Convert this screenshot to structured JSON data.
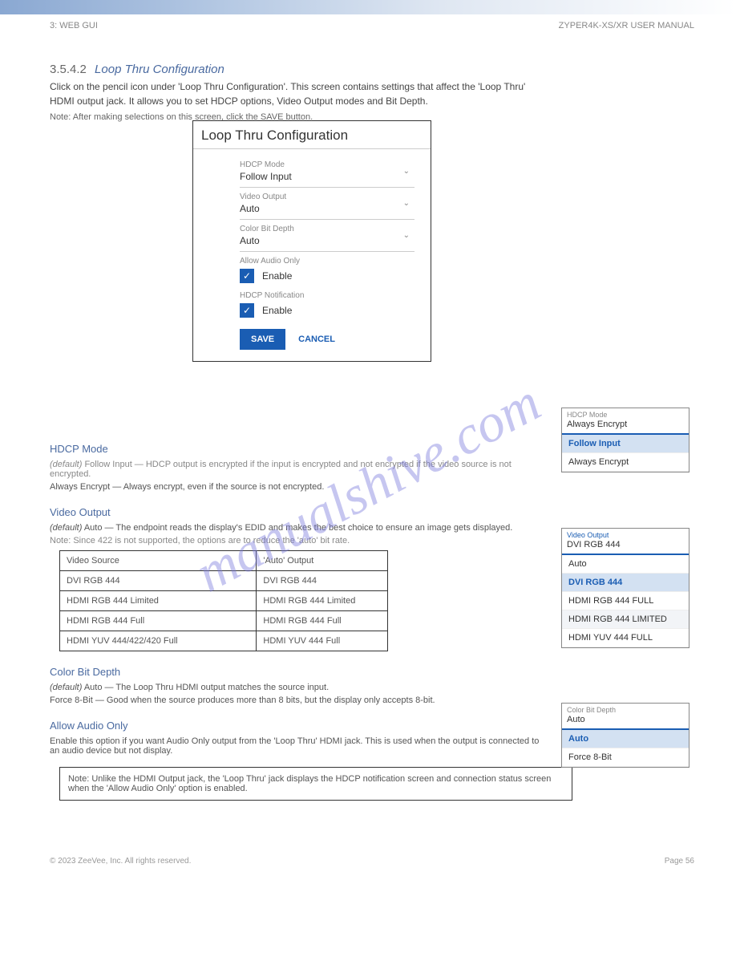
{
  "header": {
    "page_ref": "3: WEB GUI",
    "doc_title": "ZYPER4K-XS/XR USER MANUAL"
  },
  "section": {
    "number": "3.5.4.2",
    "title": "Loop Thru Configuration",
    "lead": "Click on the pencil icon under 'Loop Thru Configuration'. This screen contains settings that affect the 'Loop Thru' HDMI output jack. It allows you to set HDCP options, Video Output modes and Bit Depth.",
    "note": "Note: After making selections on this screen, click the SAVE button."
  },
  "panel": {
    "title": "Loop Thru Configuration",
    "hdcp_mode": {
      "label": "HDCP Mode",
      "value": "Follow Input"
    },
    "video_output": {
      "label": "Video Output",
      "value": "Auto"
    },
    "color_bit_depth": {
      "label": "Color Bit Depth",
      "value": "Auto"
    },
    "allow_audio_only": {
      "label": "Allow Audio Only",
      "enable": "Enable"
    },
    "hdcp_notification": {
      "label": "HDCP Notification",
      "enable": "Enable"
    },
    "save": "SAVE",
    "cancel": "CANCEL"
  },
  "hdcp_section": {
    "heading": "HDCP Mode",
    "default_label": "default",
    "default_text": "Follow Input — HDCP output is encrypted if the input is encrypted and not encrypted if the video source is not encrypted.",
    "always_text": "Always Encrypt — Always encrypt, even if the source is not encrypted."
  },
  "video_output_section": {
    "heading": "Video Output",
    "default_label": "default",
    "body": "Auto — The endpoint reads the display's EDID and makes the best choice to ensure an image gets displayed.",
    "note": "Note: Since 422 is not supported, the options are to reduce the 'auto' bit rate.",
    "table": {
      "hdr_col1": "Video Source",
      "hdr_col2": "'Auto' Output",
      "rows": [
        [
          "DVI RGB 444",
          "DVI RGB 444"
        ],
        [
          "HDMI RGB 444 Limited",
          "HDMI RGB 444 Limited"
        ],
        [
          "HDMI RGB 444 Full",
          "HDMI RGB 444 Full"
        ],
        [
          "HDMI YUV 444/422/420 Full",
          "HDMI YUV 444 Full"
        ]
      ]
    }
  },
  "color_bit_section": {
    "heading": "Color Bit Depth",
    "default_label": "default",
    "auto_text": "Auto — The Loop Thru HDMI output matches the source input.",
    "force_text": "Force 8-Bit — Good when the source produces more than 8 bits, but the display only accepts 8-bit."
  },
  "allow_audio_section": {
    "heading": "Allow Audio Only",
    "body": "Enable this option if you want Audio Only output from the 'Loop Thru' HDMI jack. This is used when the output is connected to an audio device but not display."
  },
  "footnote": "Note: Unlike the HDMI Output jack, the 'Loop Thru' jack displays the HDCP notification screen and connection status screen when the 'Allow Audio Only' option is enabled.",
  "dd_hdcp": {
    "label": "HDCP Mode",
    "value": "Always Encrypt",
    "opts": [
      "Follow Input",
      "Always Encrypt"
    ]
  },
  "dd_video": {
    "label": "Video Output",
    "value": "DVI RGB 444",
    "opts": [
      "Auto",
      "DVI RGB 444",
      "HDMI RGB 444 FULL",
      "HDMI RGB 444 LIMITED",
      "HDMI YUV 444 FULL"
    ]
  },
  "dd_color": {
    "label": "Color Bit Depth",
    "value": "Auto",
    "opts": [
      "Auto",
      "Force 8-Bit"
    ]
  },
  "footer": {
    "left": "© 2023 ZeeVee, Inc. All rights reserved.",
    "right": "Page 56"
  },
  "watermark": "manualshive.com"
}
